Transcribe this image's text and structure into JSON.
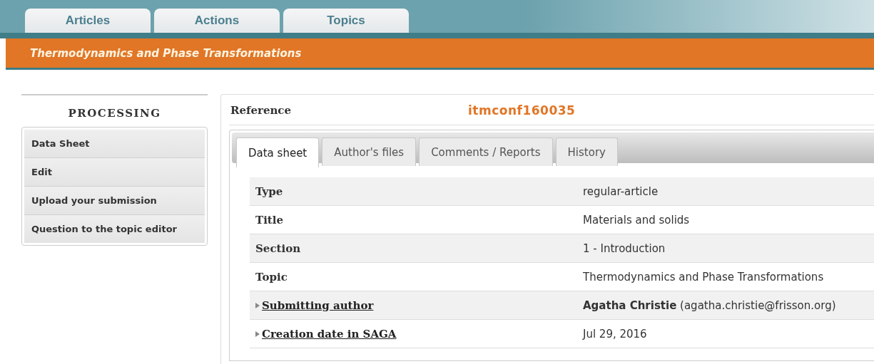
{
  "nav_tabs": [
    {
      "label": "Articles"
    },
    {
      "label": "Actions"
    },
    {
      "label": "Topics"
    }
  ],
  "banner": {
    "title": "Thermodynamics and Phase Transformations"
  },
  "sidebar": {
    "heading": "PROCESSING",
    "items": [
      "Data Sheet",
      "Edit",
      "Upload your submission",
      "Question to the topic editor"
    ]
  },
  "reference": {
    "label": "Reference",
    "value": "itmconf160035"
  },
  "tabs": [
    {
      "label": "Data sheet",
      "selected": true
    },
    {
      "label": "Author's files",
      "selected": false
    },
    {
      "label": "Comments / Reports",
      "selected": false
    },
    {
      "label": "History",
      "selected": false
    }
  ],
  "rows": [
    {
      "kind": "plain",
      "label": "Type",
      "value": "regular-article"
    },
    {
      "kind": "plain",
      "label": "Title",
      "value": "Materials and solids"
    },
    {
      "kind": "plain",
      "label": "Section",
      "value": "1 - Introduction"
    },
    {
      "kind": "plain",
      "label": "Topic",
      "value": "Thermodynamics and Phase Transformations"
    },
    {
      "kind": "expandable",
      "label": "Submitting author",
      "value": "**Agatha Christie** (agatha.christie@frisson.org)"
    },
    {
      "kind": "expandable",
      "label": "Creation date in SAGA",
      "value": "Jul 29, 2016"
    }
  ]
}
